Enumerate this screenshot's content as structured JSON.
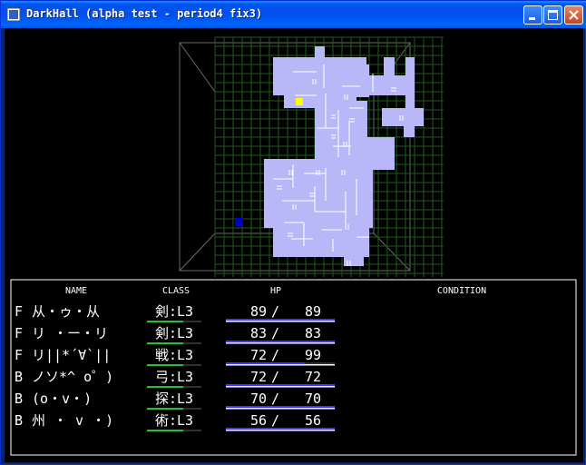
{
  "window": {
    "title": "DarkHall (alpha test - period4 fix3)",
    "icons": [
      "app-icon",
      "minimize-icon",
      "maximize-icon",
      "close-icon"
    ]
  },
  "party": {
    "headers": {
      "name": "NAME",
      "class": "CLASS",
      "hp": "HP",
      "condition": "CONDITION"
    },
    "members": [
      {
        "row": "F",
        "name": "从・ゥ・从",
        "class": "剣:L3",
        "hp": "89",
        "maxhp": "89",
        "condition": "",
        "hp_fraction": 1.0
      },
      {
        "row": "F",
        "name": "リ ・ー・リ",
        "class": "剣:L3",
        "hp": "83",
        "maxhp": "83",
        "condition": "",
        "hp_fraction": 1.0
      },
      {
        "row": "F",
        "name": "リ||*´∀`||",
        "class": "戦:L3",
        "hp": "72",
        "maxhp": "99",
        "condition": "",
        "hp_fraction": 0.727
      },
      {
        "row": "B",
        "name": "ノソ*^ o゜)",
        "class": "弓:L3",
        "hp": "72",
        "maxhp": "72",
        "condition": "",
        "hp_fraction": 1.0
      },
      {
        "row": "B",
        "name": "(o・v・)",
        "class": "探:L3",
        "hp": "70",
        "maxhp": "70",
        "condition": "",
        "hp_fraction": 1.0
      },
      {
        "row": "B",
        "name": "州 ・ v ・)",
        "class": "術:L3",
        "hp": "56",
        "maxhp": "56",
        "condition": "",
        "hp_fraction": 1.0
      }
    ]
  },
  "colors": {
    "map_floor": "#b8b8f8",
    "map_grid": "#1e5a1e",
    "player_marker": "#ffff00",
    "stairs_marker": "#0000c0",
    "hp_bar": "#3a3aff",
    "class_bar": "#20c040",
    "frame": "#ffffff"
  }
}
